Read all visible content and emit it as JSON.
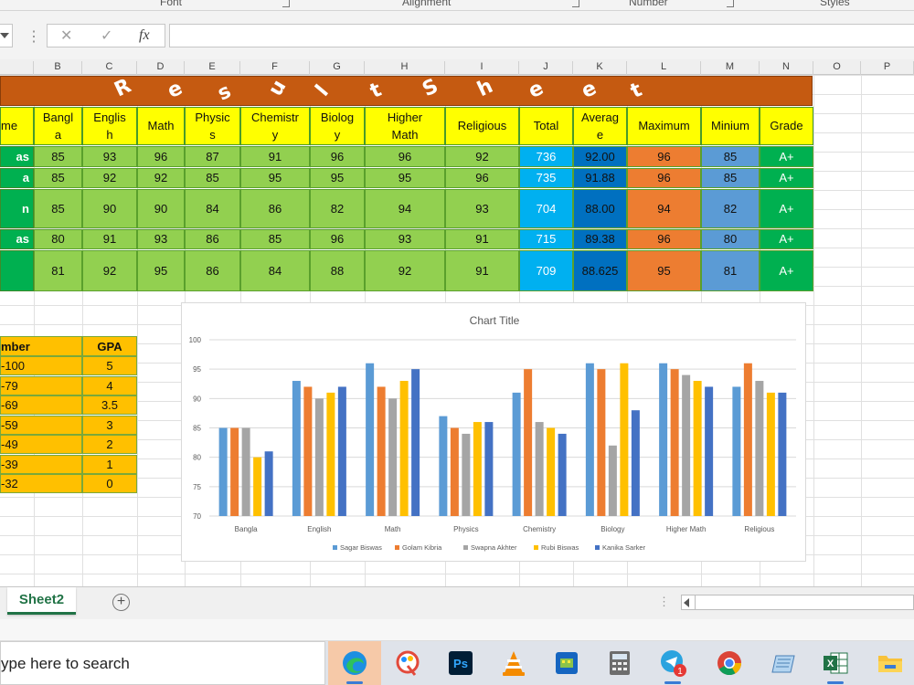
{
  "ribbon": {
    "groups": [
      "Font",
      "Alignment",
      "Number",
      "Styles"
    ]
  },
  "formula_bar": {
    "cancel": "✕",
    "enter": "✓",
    "fx": "fx",
    "value": ""
  },
  "columns": [
    "B",
    "C",
    "D",
    "E",
    "F",
    "G",
    "H",
    "I",
    "J",
    "K",
    "L",
    "M",
    "N",
    "O",
    "P"
  ],
  "title_letters": [
    "R",
    "e",
    "s",
    "u",
    "l",
    "t",
    "S",
    "h",
    "e",
    "e",
    "t"
  ],
  "headers": [
    "me",
    "Bangl\na",
    "Englis\nh",
    "Math",
    "Physic\ns",
    "Chemistr\ny",
    "Biolog\ny",
    "Higher\nMath",
    "Religious",
    "Total",
    "Averag\ne",
    "Maximum",
    "Minium",
    "Grade"
  ],
  "rows": [
    {
      "name": "as",
      "scores": [
        "85",
        "93",
        "96",
        "87",
        "91",
        "96",
        "96",
        "92"
      ],
      "total": "736",
      "average": "92.00",
      "max": "96",
      "min": "85",
      "grade": "A+"
    },
    {
      "name": "a",
      "scores": [
        "85",
        "92",
        "92",
        "85",
        "95",
        "95",
        "95",
        "96"
      ],
      "total": "735",
      "average": "91.88",
      "max": "96",
      "min": "85",
      "grade": "A+"
    },
    {
      "name": "n",
      "scores": [
        "85",
        "90",
        "90",
        "84",
        "86",
        "82",
        "94",
        "93"
      ],
      "total": "704",
      "average": "88.00",
      "max": "94",
      "min": "82",
      "grade": "A+"
    },
    {
      "name": "as",
      "scores": [
        "80",
        "91",
        "93",
        "86",
        "85",
        "96",
        "93",
        "91"
      ],
      "total": "715",
      "average": "89.38",
      "max": "96",
      "min": "80",
      "grade": "A+"
    },
    {
      "name": "",
      "scores": [
        "81",
        "92",
        "95",
        "86",
        "84",
        "88",
        "92",
        "91"
      ],
      "total": "709",
      "average": "88.625",
      "max": "95",
      "min": "81",
      "grade": "A+"
    }
  ],
  "gpa_table": {
    "header": [
      "mber",
      "GPA"
    ],
    "rows": [
      [
        "-100",
        "5"
      ],
      [
        "-79",
        "4"
      ],
      [
        "-69",
        "3.5"
      ],
      [
        "-59",
        "3"
      ],
      [
        "-49",
        "2"
      ],
      [
        "-39",
        "1"
      ],
      [
        "-32",
        "0"
      ]
    ]
  },
  "chart_data": {
    "type": "bar",
    "title": "Chart Title",
    "categories": [
      "Bangla",
      "English",
      "Math",
      "Physics",
      "Chemistry",
      "Biology",
      "Higher Math",
      "Religious"
    ],
    "ylim": [
      70,
      100
    ],
    "yticks": [
      "100",
      "95",
      "90",
      "85",
      "80",
      "75",
      "70"
    ],
    "grid": true,
    "legend": "bottom",
    "series": [
      {
        "name": "Sagar Biswas",
        "color": "#5b9bd5",
        "values": [
          85,
          93,
          96,
          87,
          91,
          96,
          96,
          92
        ]
      },
      {
        "name": "Golam Kibria",
        "color": "#ed7d31",
        "values": [
          85,
          92,
          92,
          85,
          95,
          95,
          95,
          96
        ]
      },
      {
        "name": "Swapna Akhter",
        "color": "#a5a5a5",
        "values": [
          85,
          90,
          90,
          84,
          86,
          82,
          94,
          93
        ]
      },
      {
        "name": "Rubi Biswas",
        "color": "#ffc000",
        "values": [
          80,
          91,
          93,
          86,
          85,
          96,
          93,
          91
        ]
      },
      {
        "name": "Kanika Sarker",
        "color": "#4472c4",
        "values": [
          81,
          92,
          95,
          86,
          84,
          88,
          92,
          91
        ]
      }
    ]
  },
  "sheet_tabs": {
    "active": "Sheet2",
    "add": "+"
  },
  "taskbar": {
    "search_text": "ype here to search",
    "icons": [
      "edge-icon",
      "paint-icon",
      "photoshop-icon",
      "vlc-icon",
      "film-icon",
      "calculator-icon",
      "telegram-icon",
      "chrome-icon",
      "notepad-icon",
      "excel-icon",
      "file-explorer-icon"
    ],
    "telegram_badge": "1",
    "ps_label": "Ps"
  }
}
